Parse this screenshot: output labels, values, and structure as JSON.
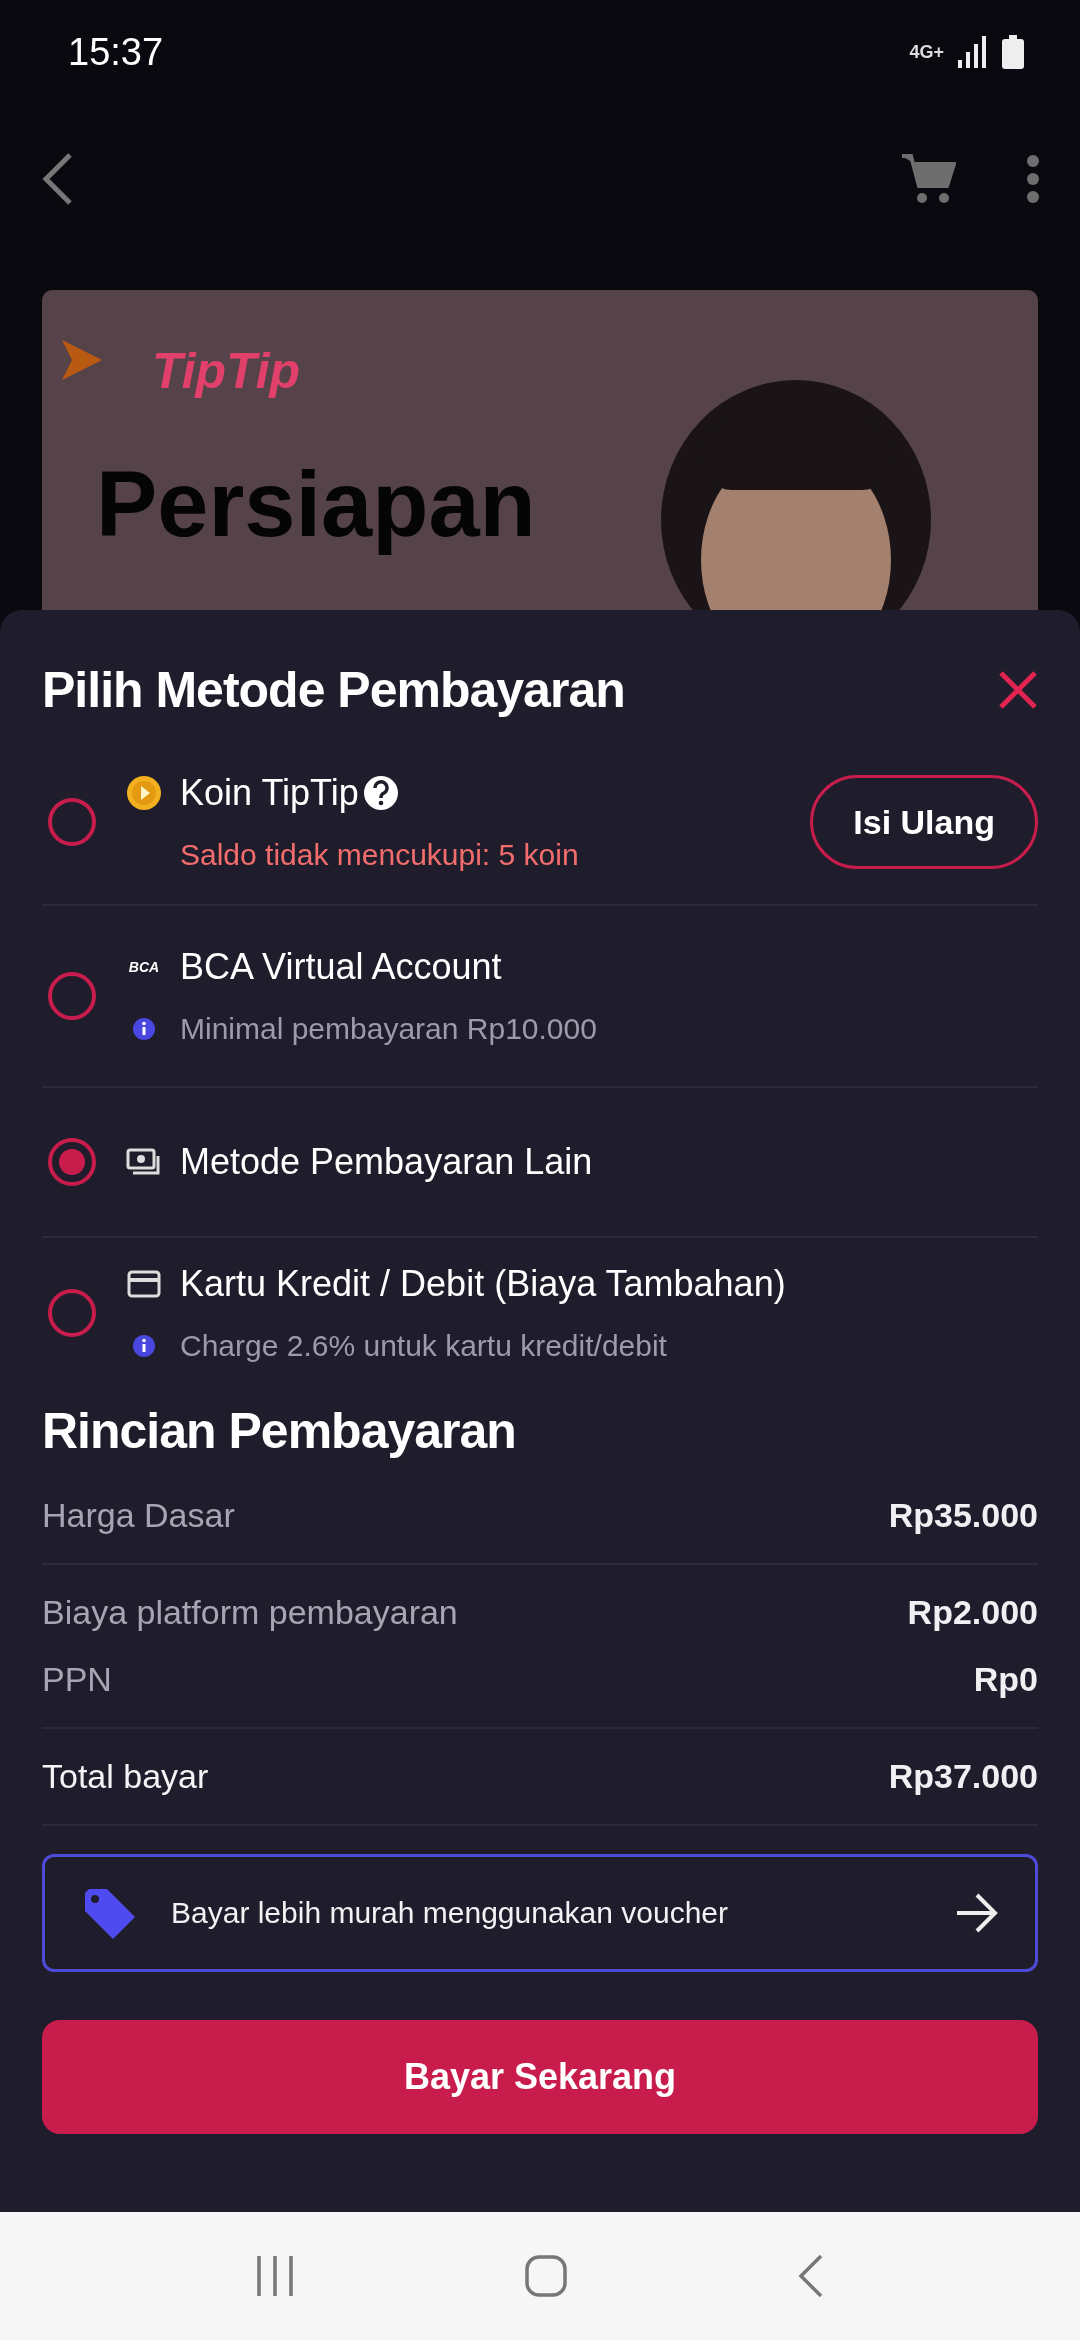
{
  "status_bar": {
    "time": "15:37",
    "network": "4G+"
  },
  "banner": {
    "logo": "TipTip",
    "title": "Persiapan"
  },
  "sheet": {
    "title": "Pilih Metode Pembayaran",
    "methods": [
      {
        "kind": "coin",
        "label": "Koin TipTip",
        "note": "Saldo tidak mencukupi: 5 koin",
        "action": "Isi Ulang",
        "selected": false
      },
      {
        "kind": "bank",
        "label": "BCA Virtual Account",
        "bank": "BCA",
        "note": "Minimal pembayaran Rp10.000",
        "selected": false
      },
      {
        "kind": "other",
        "label": "Metode Pembayaran Lain",
        "selected": true
      },
      {
        "kind": "card",
        "label": "Kartu Kredit / Debit (Biaya Tambahan)",
        "note": "Charge 2.6% untuk kartu kredit/debit",
        "selected": false
      }
    ],
    "summary_title": "Rincian Pembayaran",
    "summary": [
      {
        "kind": "line",
        "label": "Harga Dasar",
        "value": "Rp35.000",
        "divider": true
      },
      {
        "kind": "line",
        "label": "Biaya platform pembayaran",
        "value": "Rp2.000",
        "divider": false
      },
      {
        "kind": "line",
        "label": "PPN",
        "value": "Rp0",
        "divider": true
      },
      {
        "kind": "total",
        "label": "Total bayar",
        "value": "Rp37.000",
        "divider": true
      }
    ],
    "voucher": "Bayar lebih murah menggunakan voucher",
    "pay_button": "Bayar Sekarang"
  }
}
